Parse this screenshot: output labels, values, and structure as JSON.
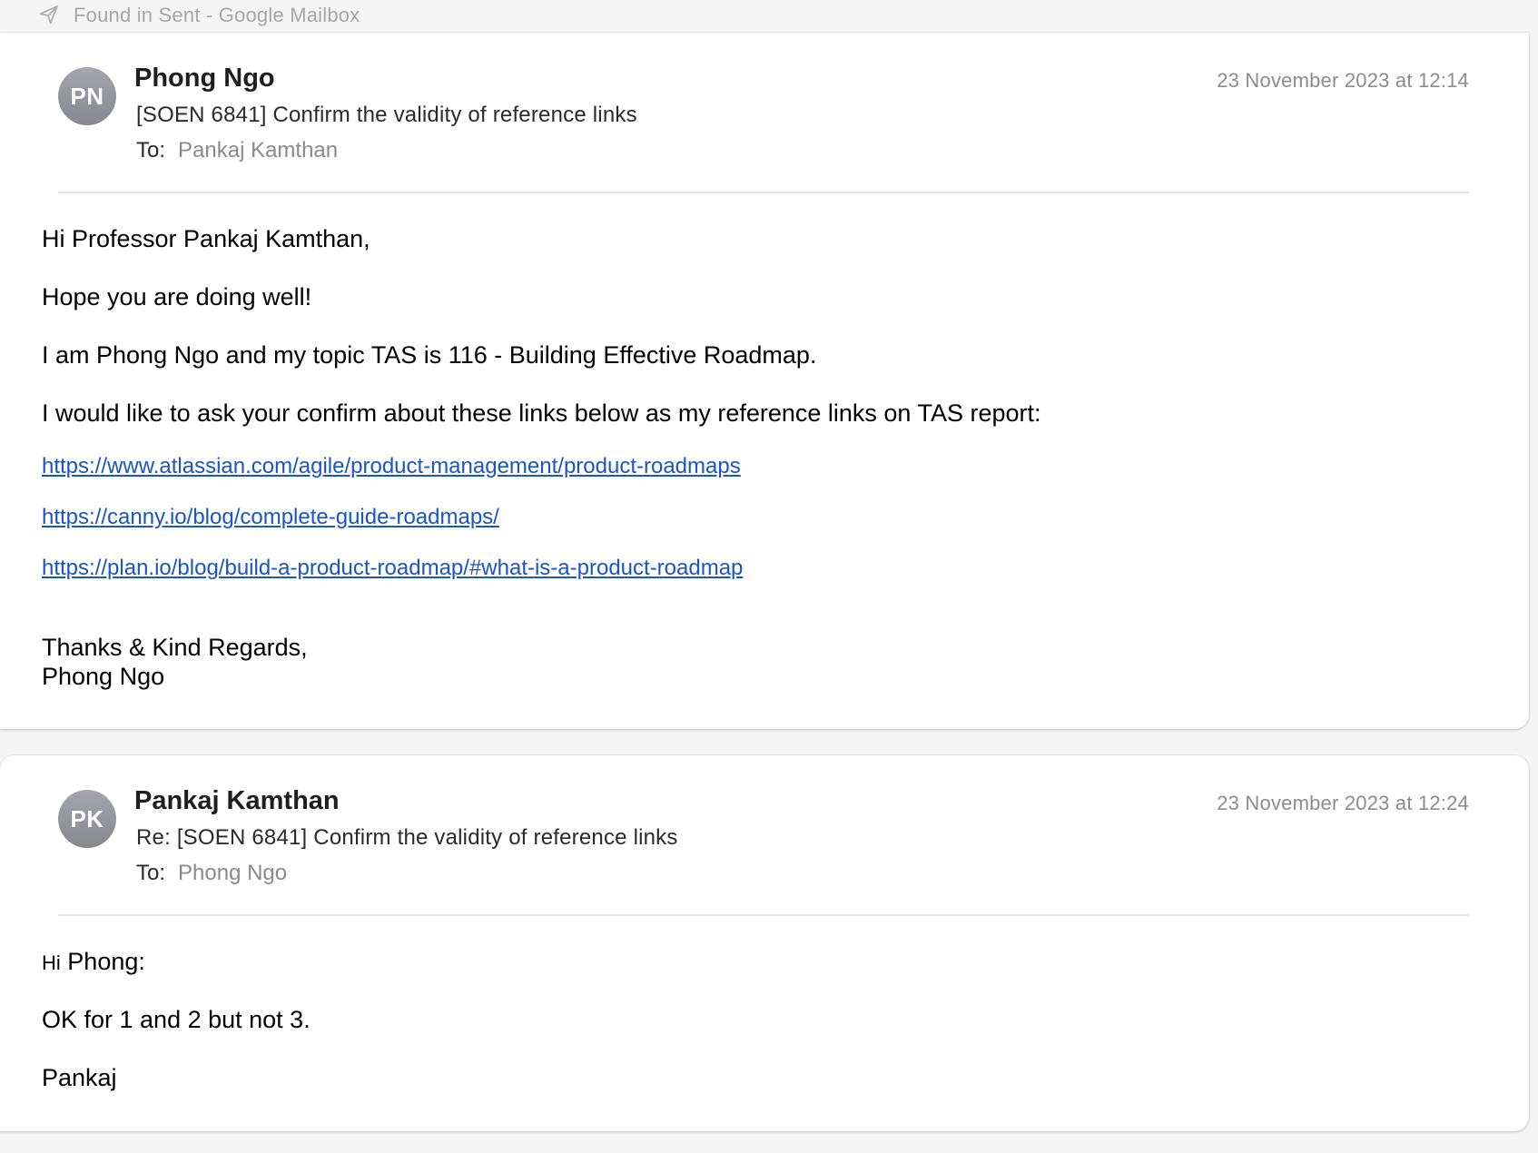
{
  "found_bar": {
    "text": "Found in Sent - Google Mailbox",
    "icon": "paper-plane-icon"
  },
  "messages": [
    {
      "avatar_initials": "PN",
      "sender": "Phong Ngo",
      "subject": "[SOEN 6841] Confirm the validity of reference links",
      "to_label": "To:",
      "to": "Pankaj Kamthan",
      "timestamp": "23 November 2023 at 12:14",
      "body": {
        "greeting": "Hi Professor Pankaj Kamthan,",
        "line1": "Hope you are doing well!",
        "line2": "I am Phong Ngo and my topic TAS is 116 - Building Effective Roadmap.",
        "line3": "I would like to ask your confirm about these links below as my reference links on TAS report:",
        "links": [
          "https://www.atlassian.com/agile/product-management/product-roadmaps",
          "https://canny.io/blog/complete-guide-roadmaps/",
          "https://plan.io/blog/build-a-product-roadmap/#what-is-a-product-roadmap"
        ],
        "signoff": "Thanks & Kind Regards,",
        "signature": "Phong Ngo"
      }
    },
    {
      "avatar_initials": "PK",
      "sender": "Pankaj Kamthan",
      "subject": "Re: [SOEN 6841] Confirm the validity of reference links",
      "to_label": "To:",
      "to": "Phong Ngo",
      "timestamp": "23 November 2023 at 12:24",
      "body": {
        "greeting_hi": "Hi",
        "greeting_name": "Phong:",
        "line1": "OK for 1 and 2 but not 3.",
        "signature": "Pankaj"
      }
    }
  ]
}
